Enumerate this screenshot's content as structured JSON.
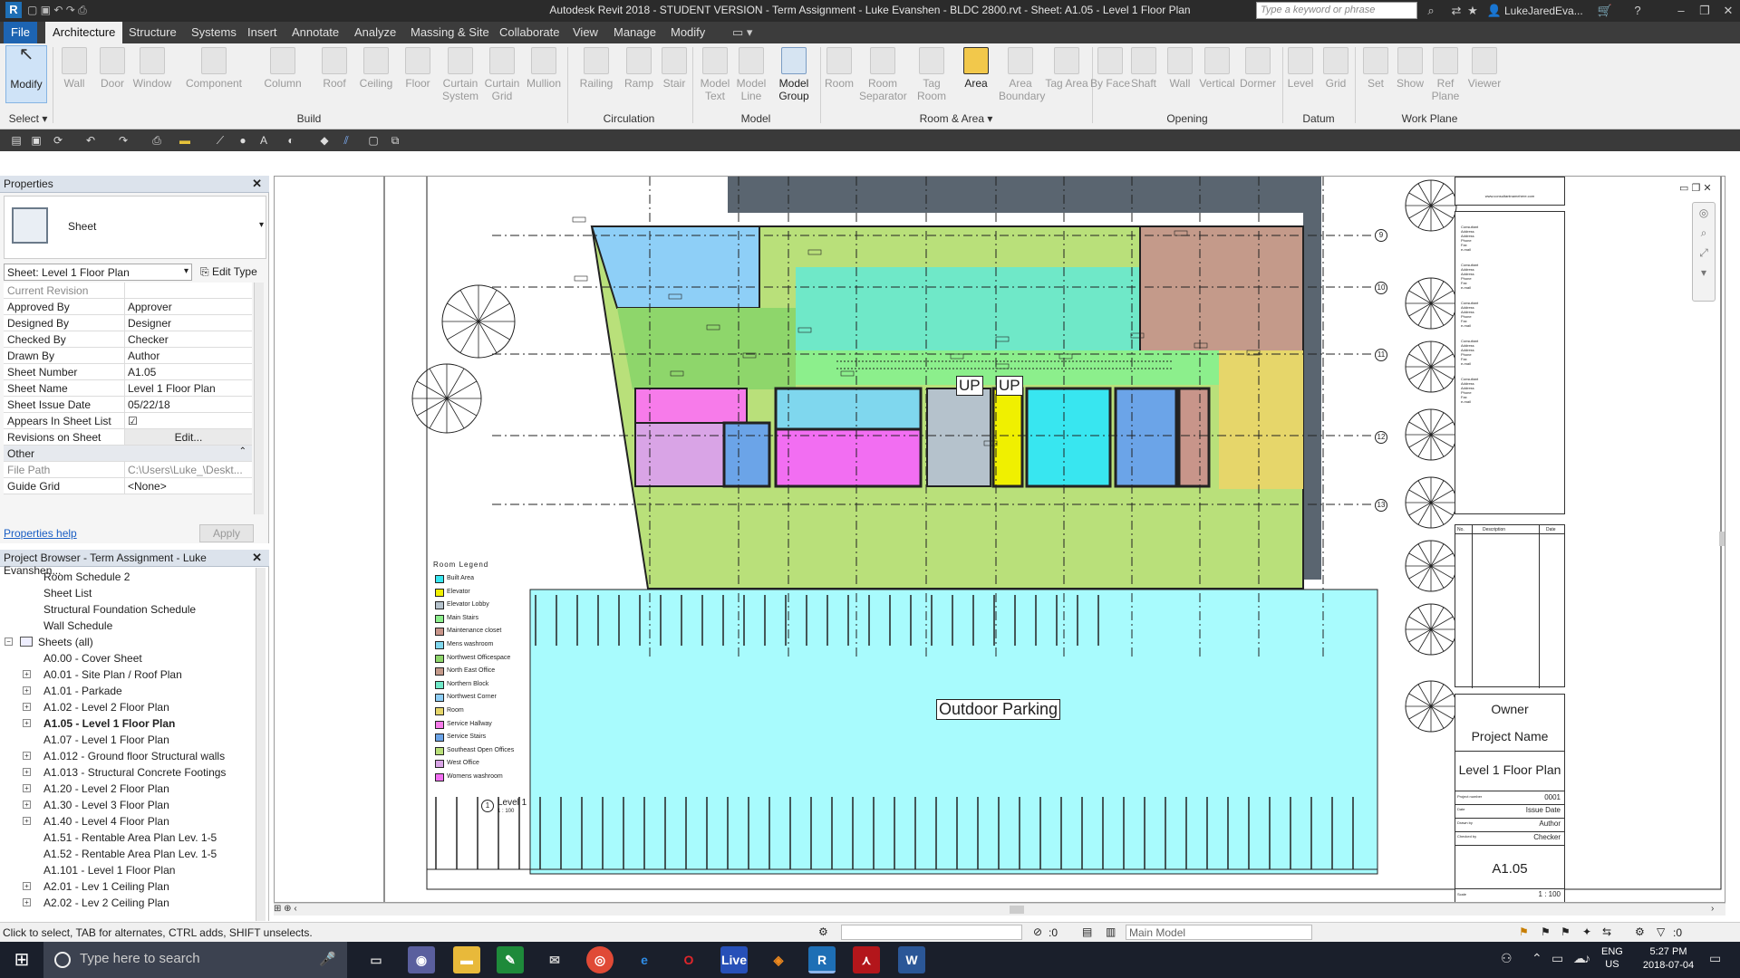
{
  "titlebar": {
    "title": "Autodesk Revit 2018 - STUDENT VERSION -     Term Assignment - Luke Evanshen - BLDC 2800.rvt - Sheet: A1.05 - Level 1 Floor Plan",
    "search_placeholder": "Type a keyword or phrase",
    "user": "LukeJaredEva..."
  },
  "ribbon_tabs": [
    "File",
    "Architecture",
    "Structure",
    "Systems",
    "Insert",
    "Annotate",
    "Analyze",
    "Massing & Site",
    "Collaborate",
    "View",
    "Manage",
    "Modify"
  ],
  "ribbon": {
    "select": {
      "modify": "Modify",
      "select_label": "Select"
    },
    "build": {
      "label": "Build",
      "buttons": [
        "Wall",
        "Door",
        "Window",
        "Component",
        "Column",
        "Roof",
        "Ceiling",
        "Floor",
        "Curtain System",
        "Curtain Grid",
        "Mullion"
      ]
    },
    "circulation": {
      "label": "Circulation",
      "buttons": [
        "Railing",
        "Ramp",
        "Stair"
      ]
    },
    "model": {
      "label": "Model",
      "buttons": [
        "Model Text",
        "Model Line",
        "Model Group"
      ]
    },
    "room_area": {
      "label": "Room & Area",
      "buttons": [
        "Room",
        "Room Separator",
        "Tag Room",
        "Area",
        "Area Boundary",
        "Tag Area"
      ]
    },
    "opening": {
      "label": "Opening",
      "buttons": [
        "By Face",
        "Shaft",
        "Wall",
        "Vertical",
        "Dormer"
      ]
    },
    "datum": {
      "label": "Datum",
      "buttons": [
        "Level",
        "Grid"
      ]
    },
    "work_plane": {
      "label": "Work Plane",
      "buttons": [
        "Set",
        "Show",
        "Ref Plane",
        "Viewer"
      ]
    }
  },
  "properties": {
    "header": "Properties",
    "type_name": "Sheet",
    "instance_filter": "Sheet: Level 1 Floor Plan",
    "edit_type": "Edit Type",
    "rows": [
      {
        "k": "Current Revision",
        "v": ""
      },
      {
        "k": "Approved By",
        "v": "Approver"
      },
      {
        "k": "Designed By",
        "v": "Designer"
      },
      {
        "k": "Checked By",
        "v": "Checker"
      },
      {
        "k": "Drawn By",
        "v": "Author"
      },
      {
        "k": "Sheet Number",
        "v": "A1.05"
      },
      {
        "k": "Sheet Name",
        "v": "Level 1 Floor Plan"
      },
      {
        "k": "Sheet Issue Date",
        "v": "05/22/18"
      },
      {
        "k": "Appears In Sheet List",
        "v": "☑"
      },
      {
        "k": "Revisions on Sheet",
        "v": "Edit..."
      },
      {
        "k": "Other",
        "v": ""
      },
      {
        "k": "File Path",
        "v": "C:\\Users\\Luke_\\Deskt..."
      },
      {
        "k": "Guide Grid",
        "v": "<None>"
      }
    ],
    "help": "Properties help",
    "apply": "Apply"
  },
  "browser": {
    "header": "Project Browser - Term Assignment - Luke Evanshen...",
    "items": [
      {
        "label": "Room Schedule 2",
        "indent": 2,
        "exp": ""
      },
      {
        "label": "Sheet List",
        "indent": 2,
        "exp": ""
      },
      {
        "label": "Structural Foundation Schedule",
        "indent": 2,
        "exp": ""
      },
      {
        "label": "Wall Schedule",
        "indent": 2,
        "exp": ""
      },
      {
        "label": "Sheets (all)",
        "indent": 0,
        "exp": "−"
      },
      {
        "label": "A0.00 - Cover Sheet",
        "indent": 1,
        "exp": ""
      },
      {
        "label": "A0.01 - Site Plan / Roof Plan",
        "indent": 1,
        "exp": "+"
      },
      {
        "label": "A1.01 - Parkade",
        "indent": 1,
        "exp": "+"
      },
      {
        "label": "A1.02 - Level 2 Floor Plan",
        "indent": 1,
        "exp": "+"
      },
      {
        "label": "A1.05 - Level 1 Floor Plan",
        "indent": 1,
        "exp": "+",
        "selected": true
      },
      {
        "label": "A1.07 - Level 1 Floor Plan",
        "indent": 1,
        "exp": ""
      },
      {
        "label": "A1.012 - Ground floor Structural walls",
        "indent": 1,
        "exp": "+"
      },
      {
        "label": "A1.013 - Structural Concrete Footings",
        "indent": 1,
        "exp": "+"
      },
      {
        "label": "A1.20 - Level 2 Floor Plan",
        "indent": 1,
        "exp": "+"
      },
      {
        "label": "A1.30 - Level 3 Floor Plan",
        "indent": 1,
        "exp": "+"
      },
      {
        "label": "A1.40 - Level 4 Floor Plan",
        "indent": 1,
        "exp": "+"
      },
      {
        "label": "A1.51 - Rentable Area Plan Lev. 1-5",
        "indent": 1,
        "exp": ""
      },
      {
        "label": "A1.52 - Rentable Area Plan Lev. 1-5",
        "indent": 1,
        "exp": ""
      },
      {
        "label": "A1.101 - Level 1 Floor Plan",
        "indent": 1,
        "exp": ""
      },
      {
        "label": "A2.01 - Lev 1 Ceiling Plan",
        "indent": 1,
        "exp": "+"
      },
      {
        "label": "A2.02 - Lev 2 Ceiling Plan",
        "indent": 1,
        "exp": "+"
      }
    ]
  },
  "drawing": {
    "outdoor_parking": "Outdoor Parking",
    "up1": "UP",
    "up2": "UP",
    "level_label": "Level 1",
    "level_scale": "1 : 100",
    "level_num": "1",
    "grid_bubbles": [
      "9",
      "10",
      "11",
      "12",
      "13"
    ],
    "legend_title": "Room  Legend",
    "legend": [
      {
        "name": "Built Area",
        "color": "#38e6f0"
      },
      {
        "name": "Elevator",
        "color": "#f0f000"
      },
      {
        "name": "Elevator Lobby",
        "color": "#b5c2cc"
      },
      {
        "name": "Main Stairs",
        "color": "#8cef8c"
      },
      {
        "name": "Maintenance closet",
        "color": "#c8958a"
      },
      {
        "name": "Mens washroom",
        "color": "#7fd7ee"
      },
      {
        "name": "Northwest Officespace",
        "color": "#8ed66b"
      },
      {
        "name": "North East Office",
        "color": "#c49a8a"
      },
      {
        "name": "Northern Block",
        "color": "#6fe8c8"
      },
      {
        "name": "Northwest Corner",
        "color": "#8ecff7"
      },
      {
        "name": "Room",
        "color": "#e6d66a"
      },
      {
        "name": "Service Hallway",
        "color": "#f77bea"
      },
      {
        "name": "Service Stairs",
        "color": "#6ba4e8"
      },
      {
        "name": "Southeast Open Offices",
        "color": "#b9e07a"
      },
      {
        "name": "West Office",
        "color": "#d9a4e6"
      },
      {
        "name": "Womens washroom",
        "color": "#f26ef2"
      }
    ],
    "room_tags": [
      "Northwest Corner",
      "Northern Block",
      "North East Office",
      "Northwest Officespace",
      "Main Stairs",
      "Service Hallway",
      "Mens washroom",
      "Elevator Lobby",
      "Elevator",
      "Built Area",
      "Service Stairs",
      "Maintenance closet",
      "Room",
      "West Office",
      "Service Stairs",
      "Womens washroom",
      "Southeast Open Offices",
      "Elevator",
      "Elevator"
    ]
  },
  "titleblock": {
    "website": "www.consultantnamehere.com",
    "consultant_lines": [
      "Consultant",
      "Address",
      "Address",
      "Phone",
      "Fax",
      "e-mail"
    ],
    "rev_headers": [
      "No.",
      "Description",
      "Date"
    ],
    "owner": "Owner",
    "project_name": "Project Name",
    "sheet_name": "Level 1 Floor Plan",
    "project_number_label": "Project number",
    "project_number": "0001",
    "date_label": "Date",
    "issue_date": "Issue Date",
    "drawn_label": "Drawn by",
    "author": "Author",
    "checked_label": "Checked by",
    "checker": "Checker",
    "sheet_number": "A1.05",
    "scale_label": "Scale",
    "scale": "1 : 100"
  },
  "status": {
    "text": "Click to select, TAB for alternates, CTRL adds, SHIFT unselects.",
    "zero1": ":0",
    "main_model": "Main Model",
    "zero2": ":0"
  },
  "taskbar": {
    "search": "Type here to search",
    "lang": "ENG",
    "region": "US",
    "time": "5:27 PM",
    "date": "2018-07-04"
  },
  "colors": {
    "accent": "#1d64b2",
    "parking": "#a8fbfd",
    "selection": "#cfe3f7"
  }
}
